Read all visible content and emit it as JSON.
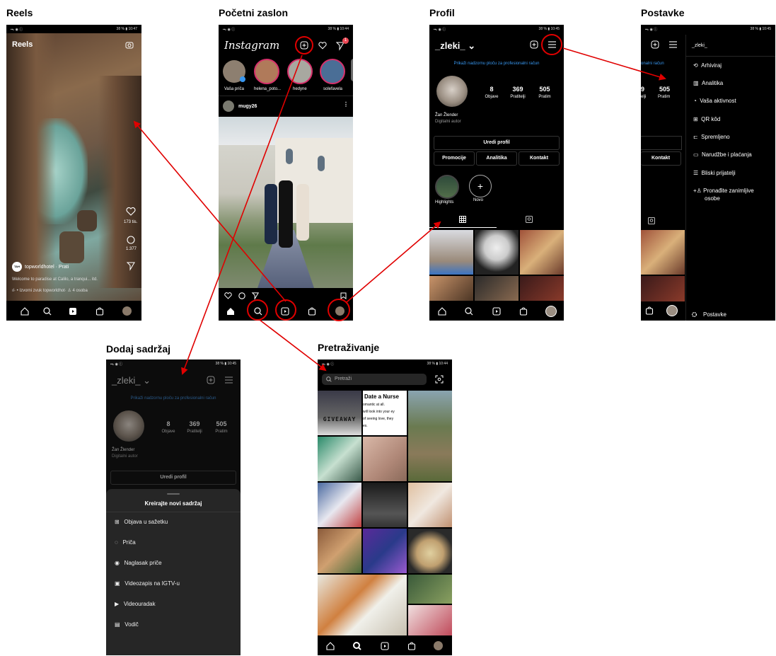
{
  "titles": {
    "reels": "Reels",
    "home": "Početni zaslon",
    "profile": "Profil",
    "settings": "Postavke",
    "add": "Dodaj sadržaj",
    "search": "Pretraživanje"
  },
  "status": {
    "left": "▪▪ᵢₗ ◉ ⓘ",
    "reels_right": "38 % ▮ 10:47",
    "home_right": "38 % ▮ 10:44",
    "profile_right": "38 % ▮ 10:45",
    "settings_right": "38 % ▮ 10:45",
    "add_right": "38 % ▮ 10:45",
    "search_right": "38 % ▮ 10:44"
  },
  "reels": {
    "header": "Reels",
    "likes": "173 tis.",
    "comments": "1.377",
    "avatar": "TAH",
    "account": "topworldhotel · Prati",
    "caption": "Welcome to paradise at Calilo, a tranqui... itd.",
    "audio": "ıl· • Izvorni zvuk   topworldhot·  ♙ 4 osoba"
  },
  "home": {
    "logo": "Instagram",
    "badge": "1",
    "stories": [
      {
        "name": "Vaša priča"
      },
      {
        "name": "helena_poto..."
      },
      {
        "name": "hedyne"
      },
      {
        "name": "solefavela"
      }
    ],
    "post_user": "mugy26"
  },
  "profile": {
    "username": "_zleki_ ⌄",
    "pro_link": "Prikaži nadzornu ploču za profesionalni račun",
    "stats": [
      {
        "value": "8",
        "label": "Objave"
      },
      {
        "value": "369",
        "label": "Pratitelji"
      },
      {
        "value": "505",
        "label": "Pratim"
      }
    ],
    "name": "Žan Žlender",
    "bio": "Digitalni autor",
    "edit": "Uredi profil",
    "promo": "Promocije",
    "analytics": "Analitika",
    "contact": "Kontakt",
    "highlight": "Highlights",
    "new": "Novo"
  },
  "settings": {
    "username": "_zleki_",
    "pro_partial": "onalni račun",
    "stat_partial_value": "9",
    "stat_partial_label": "elji",
    "stat_value": "505",
    "stat_label": "Pratim",
    "contact": "Kontakt",
    "menu": [
      {
        "label": "Arhiviraj"
      },
      {
        "label": "Analitika"
      },
      {
        "label": "Vaša aktivnost"
      },
      {
        "label": "QR kôd"
      },
      {
        "label": "Spremljeno"
      },
      {
        "label": "Narudžbe i plaćanja"
      },
      {
        "label": "Bliski prijatelji"
      },
      {
        "label": "Pronađite zanimljive"
      },
      {
        "label": "osobe"
      }
    ],
    "footer": "Postavke"
  },
  "add": {
    "username": "_zleki_ ⌄",
    "pro_link": "Prikaži nadzornu ploču za profesionalni račun",
    "stats": [
      {
        "value": "8",
        "label": "Objave"
      },
      {
        "value": "369",
        "label": "Pratitelji"
      },
      {
        "value": "505",
        "label": "Pratim"
      }
    ],
    "name": "Žan Žlender",
    "bio": "Digitalni autor",
    "edit": "Uredi profil",
    "sheet_title": "Kreirajte novi sadržaj",
    "options": [
      {
        "label": "Objava u sažetku"
      },
      {
        "label": "Priča"
      },
      {
        "label": "Naglasak priče"
      },
      {
        "label": "Videozapis na IGTV-u"
      },
      {
        "label": "Videouradak"
      },
      {
        "label": "Vodič"
      }
    ]
  },
  "search": {
    "placeholder": "Pretraži",
    "giveaway": "GIVEAWAY",
    "nurse_title": "Date a Nurse",
    "nurse_l1": "omantic at all.",
    "nurse_l2": "will look into your ey",
    "nurse_l3": "of seeing love, they",
    "nurse_l4": "es."
  },
  "colors": {
    "arrow": "#e00000",
    "link": "#3897f0",
    "background": "#000000"
  }
}
